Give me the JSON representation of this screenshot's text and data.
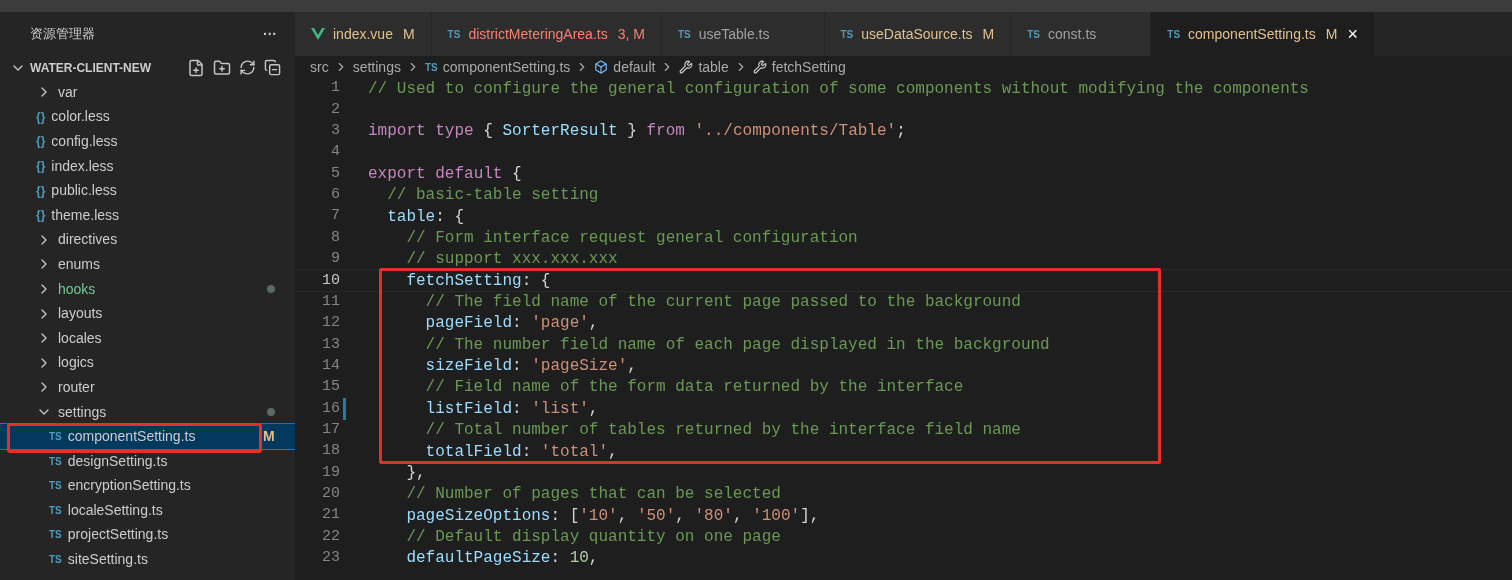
{
  "sidebar": {
    "title": "资源管理器",
    "more": "···",
    "section": {
      "label": "WATER-CLIENT-NEW",
      "expanded": true
    },
    "tree": [
      {
        "children": [
          {
            "label": "var",
            "kind": "folder",
            "expanded": false
          },
          {
            "label": "color.less",
            "kind": "less",
            "icon": "{}"
          },
          {
            "label": "config.less",
            "kind": "less",
            "icon": "{}"
          },
          {
            "label": "index.less",
            "kind": "less",
            "icon": "{}"
          },
          {
            "label": "public.less",
            "kind": "less",
            "icon": "{}"
          },
          {
            "label": "theme.less",
            "kind": "less",
            "icon": "{}"
          }
        ]
      },
      {
        "label": "directives",
        "kind": "folder",
        "expanded": false
      },
      {
        "label": "enums",
        "kind": "folder",
        "expanded": false
      },
      {
        "label": "hooks",
        "kind": "folder",
        "expanded": false,
        "color": "#73c991",
        "dot": true
      },
      {
        "label": "layouts",
        "kind": "folder",
        "expanded": false
      },
      {
        "label": "locales",
        "kind": "folder",
        "expanded": false
      },
      {
        "label": "logics",
        "kind": "folder",
        "expanded": false
      },
      {
        "label": "router",
        "kind": "folder",
        "expanded": false
      },
      {
        "label": "settings",
        "kind": "folder",
        "expanded": true,
        "dot": true,
        "children": [
          {
            "label": "componentSetting.ts",
            "kind": "ts",
            "icon": "TS",
            "badge": "M",
            "selected": true
          },
          {
            "label": "designSetting.ts",
            "kind": "ts",
            "icon": "TS",
            "selected": false
          },
          {
            "label": "encryptionSetting.ts",
            "kind": "ts",
            "icon": "TS",
            "selected": false
          },
          {
            "label": "localeSetting.ts",
            "kind": "ts",
            "icon": "TS",
            "selected": false
          },
          {
            "label": "projectSetting.ts",
            "kind": "ts",
            "icon": "TS",
            "selected": false
          },
          {
            "label": "siteSetting.ts",
            "kind": "ts",
            "icon": "TS",
            "selected": false
          }
        ]
      }
    ]
  },
  "tabs": [
    {
      "label": "index.vue",
      "kind": "vue",
      "badge": "M",
      "color": "#e2c08d",
      "selected": false
    },
    {
      "label": "districtMeteringArea.ts",
      "kind": "ts",
      "icon": "TS",
      "badge": "3, M",
      "color": "#f88070",
      "selected": false
    },
    {
      "label": "useTable.ts",
      "kind": "ts",
      "icon": "TS",
      "color": "#a0a0a0",
      "selected": false
    },
    {
      "label": "useDataSource.ts",
      "kind": "ts",
      "icon": "TS",
      "badge": "M",
      "color": "#e2c08d",
      "selected": false
    },
    {
      "label": "const.ts",
      "kind": "ts",
      "icon": "TS",
      "color": "#a0a0a0",
      "selected": false
    },
    {
      "label": "componentSetting.ts",
      "kind": "ts",
      "icon": "TS",
      "badge": "M",
      "color": "#e2c08d",
      "selected": true,
      "close": "×"
    }
  ],
  "breadcrumbs": [
    {
      "label": "src",
      "kind": "folder"
    },
    {
      "label": "settings",
      "kind": "folder"
    },
    {
      "label": "componentSetting.ts",
      "kind": "ts",
      "icon": "TS"
    },
    {
      "label": "default",
      "kind": "module"
    },
    {
      "label": "table",
      "kind": "property"
    },
    {
      "label": "fetchSetting",
      "kind": "property"
    }
  ],
  "editor": {
    "lines": [
      {
        "number": "1",
        "current": false,
        "changed": false,
        "tokens": [
          {
            "text": "// Used to configure the general configuration of some components without modifying the components",
            "kind": "comment"
          }
        ]
      },
      {
        "number": "2",
        "current": false,
        "changed": false
      },
      {
        "number": "3",
        "current": false,
        "changed": false,
        "tokens": [
          {
            "text": "import",
            "kind": "keyword"
          },
          {
            "text": " type",
            "kind": "keyword"
          },
          {
            "text": " {",
            "kind": "punct"
          },
          {
            "text": " SorterResult",
            "kind": "name"
          },
          {
            "text": " }",
            "kind": "punct"
          },
          {
            "text": " from",
            "kind": "keyword"
          },
          {
            "text": " '../components/Table'",
            "kind": "string"
          },
          {
            "text": ";",
            "kind": "punct"
          }
        ]
      },
      {
        "number": "4",
        "current": false,
        "changed": false
      },
      {
        "number": "5",
        "current": false,
        "changed": false,
        "tokens": [
          {
            "text": "export",
            "kind": "keyword"
          },
          {
            "text": " default",
            "kind": "keyword"
          },
          {
            "text": " {",
            "kind": "punct"
          }
        ]
      },
      {
        "number": "6",
        "current": false,
        "changed": false,
        "tokens": [
          {
            "text": "  // basic-table setting",
            "kind": "comment"
          }
        ]
      },
      {
        "number": "7",
        "current": false,
        "changed": false,
        "tokens": [
          {
            "text": "  table",
            "kind": "name"
          },
          {
            "text": ": {",
            "kind": "punct"
          }
        ]
      },
      {
        "number": "8",
        "current": false,
        "changed": false,
        "tokens": [
          {
            "text": "    // Form interface request general configuration",
            "kind": "comment"
          }
        ]
      },
      {
        "number": "9",
        "current": false,
        "changed": false,
        "tokens": [
          {
            "text": "    // support xxx.xxx.xxx",
            "kind": "comment"
          }
        ]
      },
      {
        "number": "10",
        "current": true,
        "changed": false,
        "tokens": [
          {
            "text": "    fetchSetting",
            "kind": "name"
          },
          {
            "text": ": {",
            "kind": "punct"
          }
        ]
      },
      {
        "number": "11",
        "current": false,
        "changed": false,
        "tokens": [
          {
            "text": "      // The field name of the current page passed to the background",
            "kind": "comment"
          }
        ]
      },
      {
        "number": "12",
        "current": false,
        "changed": false,
        "tokens": [
          {
            "text": "      pageField",
            "kind": "name"
          },
          {
            "text": ":",
            "kind": "punct"
          },
          {
            "text": " 'page'",
            "kind": "string"
          },
          {
            "text": ",",
            "kind": "punct"
          }
        ]
      },
      {
        "number": "13",
        "current": false,
        "changed": false,
        "tokens": [
          {
            "text": "      // The number field name of each page displayed in the background",
            "kind": "comment"
          }
        ]
      },
      {
        "number": "14",
        "current": false,
        "changed": false,
        "tokens": [
          {
            "text": "      sizeField",
            "kind": "name"
          },
          {
            "text": ":",
            "kind": "punct"
          },
          {
            "text": " 'pageSize'",
            "kind": "string"
          },
          {
            "text": ",",
            "kind": "punct"
          }
        ]
      },
      {
        "number": "15",
        "current": false,
        "changed": false,
        "tokens": [
          {
            "text": "      // Field name of the form data returned by the interface",
            "kind": "comment"
          }
        ]
      },
      {
        "number": "16",
        "current": false,
        "changed": true,
        "tokens": [
          {
            "text": "      listField",
            "kind": "name"
          },
          {
            "text": ":",
            "kind": "punct"
          },
          {
            "text": " 'list'",
            "kind": "string"
          },
          {
            "text": ",",
            "kind": "punct"
          }
        ]
      },
      {
        "number": "17",
        "current": false,
        "changed": false,
        "tokens": [
          {
            "text": "      // Total number of tables returned by the interface field name",
            "kind": "comment"
          }
        ]
      },
      {
        "number": "18",
        "current": false,
        "changed": false,
        "tokens": [
          {
            "text": "      totalField",
            "kind": "name"
          },
          {
            "text": ":",
            "kind": "punct"
          },
          {
            "text": " 'total'",
            "kind": "string"
          },
          {
            "text": ",",
            "kind": "punct"
          }
        ]
      },
      {
        "number": "19",
        "current": false,
        "changed": false,
        "tokens": [
          {
            "text": "    },",
            "kind": "punct"
          }
        ]
      },
      {
        "number": "20",
        "current": false,
        "changed": false,
        "tokens": [
          {
            "text": "    // Number of pages that can be selected",
            "kind": "comment"
          }
        ]
      },
      {
        "number": "21",
        "current": false,
        "changed": false,
        "tokens": [
          {
            "text": "    pageSizeOptions",
            "kind": "name"
          },
          {
            "text": ": [",
            "kind": "punct"
          },
          {
            "text": "'10'",
            "kind": "string"
          },
          {
            "text": ",",
            "kind": "punct"
          },
          {
            "text": " '50'",
            "kind": "string"
          },
          {
            "text": ",",
            "kind": "punct"
          },
          {
            "text": " '80'",
            "kind": "string"
          },
          {
            "text": ",",
            "kind": "punct"
          },
          {
            "text": " '100'",
            "kind": "string"
          },
          {
            "text": "],",
            "kind": "punct"
          }
        ]
      },
      {
        "number": "22",
        "current": false,
        "changed": false,
        "tokens": [
          {
            "text": "    // Default display quantity on one page",
            "kind": "comment"
          }
        ]
      },
      {
        "number": "23",
        "current": false,
        "changed": false,
        "tokens": [
          {
            "text": "    defaultPageSize",
            "kind": "name"
          },
          {
            "text": ":",
            "kind": "punct"
          },
          {
            "text": " 10",
            "kind": "number"
          },
          {
            "text": ",",
            "kind": "punct"
          }
        ]
      }
    ]
  }
}
